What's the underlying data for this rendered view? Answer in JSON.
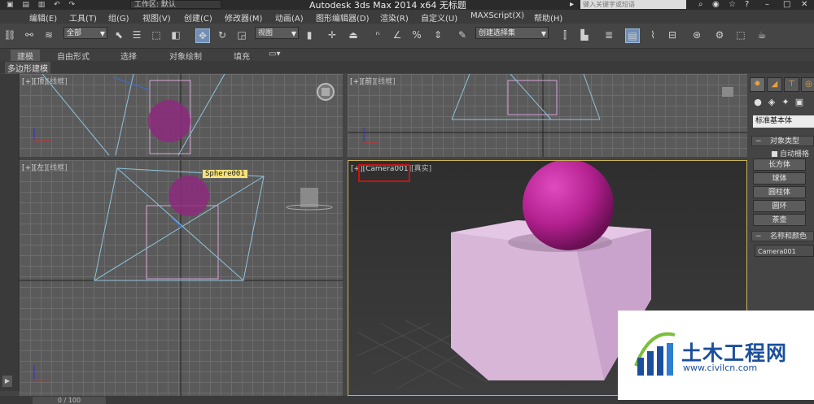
{
  "titlebar": {
    "workspace": "工作区: 默认",
    "app_title": "Autodesk 3ds Max  2014 x64      无标题",
    "search_placeholder": "键入关键字或短语"
  },
  "menu": [
    "编辑(E)",
    "工具(T)",
    "组(G)",
    "视图(V)",
    "创建(C)",
    "修改器(M)",
    "动画(A)",
    "图形编辑器(D)",
    "渲染(R)",
    "自定义(U)",
    "MAXScript(X)",
    "帮助(H)"
  ],
  "toolbar": {
    "selection_filter": "全部",
    "ref_coord": "视图",
    "named_selection": "创建选择集"
  },
  "ribbon": {
    "tabs": [
      "建模",
      "自由形式",
      "选择",
      "对象绘制",
      "填充"
    ],
    "subtab": "多边形建模"
  },
  "viewports": {
    "top": {
      "plus": "[+]",
      "name": "[顶]",
      "shade": "[线框]"
    },
    "front": {
      "plus": "[+]",
      "name": "[前]",
      "shade": "[线框]"
    },
    "left": {
      "plus": "[+]",
      "name": "[左]",
      "shade": "[线框]"
    },
    "persp": {
      "plus": "[+]",
      "name": "[Camera001]",
      "shade": "[真实]"
    },
    "tooltip": "Sphere001"
  },
  "command_panel": {
    "category_dropdown": "标准基本体",
    "object_type_title": "对象类型",
    "autogrid_label": "自动栅格",
    "buttons": [
      "长方体",
      "球体",
      "圆柱体",
      "圆环",
      "茶壶"
    ],
    "name_color_title": "名称和颜色",
    "name_value": "Camera001"
  },
  "timeline": {
    "frame": "0 / 100"
  },
  "watermark": {
    "brand": "土木工程网",
    "url": "www.civilcn.com"
  },
  "colors": {
    "sphere": "#b3208f",
    "box": "#d7b6d8",
    "wireframe": "#8ec4dc",
    "selected_border": "#c8b45a",
    "highlight_red": "#d01010",
    "brand_blue": "#1b4f9c"
  }
}
